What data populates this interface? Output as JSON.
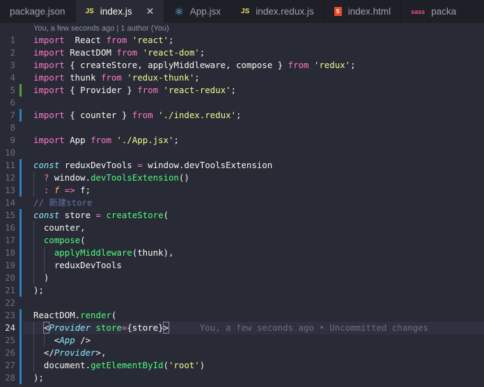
{
  "tabs": [
    {
      "icon": "",
      "icon_name": "json-file-icon",
      "label": "package.json",
      "active": false
    },
    {
      "icon": "JS",
      "icon_name": "js-file-icon",
      "label": "index.js",
      "active": true,
      "close": "✕"
    },
    {
      "icon": "⚛",
      "icon_name": "react-file-icon",
      "label": "App.jsx",
      "active": false
    },
    {
      "icon": "JS",
      "icon_name": "js-file-icon",
      "label": "index.redux.js",
      "active": false
    },
    {
      "icon": "5",
      "icon_name": "html-file-icon",
      "label": "index.html",
      "active": false
    },
    {
      "icon": "sass",
      "icon_name": "sass-file-icon",
      "label": "packa",
      "active": false
    }
  ],
  "codelens": "You, a few seconds ago | 1 author (You)",
  "blame_text": "You, a few seconds ago • Uncommitted changes",
  "current_line": 24,
  "colors": {
    "background": "#282a36",
    "keyword": "#ff79c6",
    "string": "#f1fa8c",
    "function": "#50fa7b",
    "comment": "#6272a4",
    "modified_gutter": "#2e7fc0",
    "added_gutter": "#5d9b3a"
  },
  "lines": [
    {
      "n": "1",
      "g": "",
      "tokens": [
        [
          "k",
          "import"
        ],
        [
          "",
          "  React "
        ],
        [
          "k",
          "from"
        ],
        [
          "",
          " "
        ],
        [
          "s",
          "'react'"
        ],
        [
          "",
          ";"
        ]
      ]
    },
    {
      "n": "2",
      "g": "",
      "tokens": [
        [
          "k",
          "import"
        ],
        [
          "",
          " ReactDOM "
        ],
        [
          "k",
          "from"
        ],
        [
          "",
          " "
        ],
        [
          "s",
          "'react-dom'"
        ],
        [
          "",
          ";"
        ]
      ]
    },
    {
      "n": "3",
      "g": "",
      "tokens": [
        [
          "k",
          "import"
        ],
        [
          "",
          " { createStore, applyMiddleware, compose } "
        ],
        [
          "k",
          "from"
        ],
        [
          "",
          " "
        ],
        [
          "s",
          "'redux'"
        ],
        [
          "",
          ";"
        ]
      ]
    },
    {
      "n": "4",
      "g": "",
      "tokens": [
        [
          "k",
          "import"
        ],
        [
          "",
          " thunk "
        ],
        [
          "k",
          "from"
        ],
        [
          "",
          " "
        ],
        [
          "s",
          "'redux-thunk'"
        ],
        [
          "",
          ";"
        ]
      ]
    },
    {
      "n": "5",
      "g": "add",
      "tokens": [
        [
          "k",
          "import"
        ],
        [
          "",
          " { Provider } "
        ],
        [
          "k",
          "from"
        ],
        [
          "",
          " "
        ],
        [
          "s",
          "'react-redux'"
        ],
        [
          "",
          ";"
        ]
      ]
    },
    {
      "n": "6",
      "g": "",
      "tokens": []
    },
    {
      "n": "7",
      "g": "mod",
      "tokens": [
        [
          "k",
          "import"
        ],
        [
          "",
          " { counter } "
        ],
        [
          "k",
          "from"
        ],
        [
          "",
          " "
        ],
        [
          "s",
          "'./index.redux'"
        ],
        [
          "",
          ";"
        ]
      ]
    },
    {
      "n": "8",
      "g": "",
      "tokens": []
    },
    {
      "n": "9",
      "g": "",
      "tokens": [
        [
          "k",
          "import"
        ],
        [
          "",
          " App "
        ],
        [
          "k",
          "from"
        ],
        [
          "",
          " "
        ],
        [
          "s",
          "'./App.jsx'"
        ],
        [
          "",
          ";"
        ]
      ]
    },
    {
      "n": "10",
      "g": "",
      "tokens": []
    },
    {
      "n": "11",
      "g": "mod",
      "tokens": [
        [
          "i",
          "const"
        ],
        [
          "",
          " reduxDevTools "
        ],
        [
          "k",
          "="
        ],
        [
          "",
          " window.devToolsExtension"
        ]
      ]
    },
    {
      "n": "12",
      "g": "mod",
      "indent": 1,
      "tokens": [
        [
          "",
          "  "
        ],
        [
          "k",
          "?"
        ],
        [
          "",
          " window."
        ],
        [
          "f",
          "devToolsExtension"
        ],
        [
          "",
          "()"
        ]
      ]
    },
    {
      "n": "13",
      "g": "mod",
      "indent": 1,
      "tokens": [
        [
          "",
          "  "
        ],
        [
          "k",
          ":"
        ],
        [
          "",
          " "
        ],
        [
          "ip",
          "f"
        ],
        [
          "",
          " "
        ],
        [
          "k",
          "=>"
        ],
        [
          "",
          " f;"
        ]
      ]
    },
    {
      "n": "14",
      "g": "",
      "tokens": [
        [
          "c",
          "// 新建store"
        ]
      ]
    },
    {
      "n": "15",
      "g": "mod",
      "tokens": [
        [
          "i",
          "const"
        ],
        [
          "",
          " store "
        ],
        [
          "k",
          "="
        ],
        [
          "",
          " "
        ],
        [
          "f",
          "createStore"
        ],
        [
          "",
          "("
        ]
      ]
    },
    {
      "n": "16",
      "g": "mod",
      "indent": 1,
      "tokens": [
        [
          "",
          "  counter,"
        ]
      ]
    },
    {
      "n": "17",
      "g": "mod",
      "indent": 1,
      "tokens": [
        [
          "",
          "  "
        ],
        [
          "f",
          "compose"
        ],
        [
          "",
          "("
        ]
      ]
    },
    {
      "n": "18",
      "g": "mod",
      "indent": 2,
      "tokens": [
        [
          "",
          "    "
        ],
        [
          "f",
          "applyMiddleware"
        ],
        [
          "",
          "(thunk),"
        ]
      ]
    },
    {
      "n": "19",
      "g": "mod",
      "indent": 2,
      "tokens": [
        [
          "",
          "    reduxDevTools"
        ]
      ]
    },
    {
      "n": "20",
      "g": "mod",
      "indent": 1,
      "tokens": [
        [
          "",
          "  )"
        ]
      ]
    },
    {
      "n": "21",
      "g": "mod",
      "tokens": [
        [
          "",
          ");"
        ]
      ]
    },
    {
      "n": "22",
      "g": "",
      "tokens": []
    },
    {
      "n": "23",
      "g": "mod",
      "tokens": [
        [
          "",
          "ReactDOM."
        ],
        [
          "f",
          "render"
        ],
        [
          "",
          "("
        ]
      ]
    },
    {
      "n": "24",
      "g": "mod",
      "indent": 1,
      "cur": true,
      "tokens": [
        [
          "",
          "  "
        ],
        [
          "br",
          "<"
        ],
        [
          "t",
          "Provider"
        ],
        [
          "",
          " "
        ],
        [
          "f",
          "store"
        ],
        [
          "k",
          "="
        ],
        [
          "",
          "{store}"
        ],
        [
          "br",
          ">"
        ],
        [
          "",
          "      "
        ]
      ]
    },
    {
      "n": "25",
      "g": "mod",
      "indent": 2,
      "tokens": [
        [
          "",
          "    <"
        ],
        [
          "t",
          "App"
        ],
        [
          "",
          " />"
        ]
      ]
    },
    {
      "n": "26",
      "g": "mod",
      "indent": 1,
      "tokens": [
        [
          "",
          "  </"
        ],
        [
          "t",
          "Provider"
        ],
        [
          "",
          ">,"
        ]
      ]
    },
    {
      "n": "27",
      "g": "mod",
      "indent": 1,
      "tokens": [
        [
          "",
          "  document."
        ],
        [
          "f",
          "getElementById"
        ],
        [
          "",
          "("
        ],
        [
          "s",
          "'root'"
        ],
        [
          "",
          ")"
        ]
      ]
    },
    {
      "n": "28",
      "g": "mod",
      "tokens": [
        [
          "",
          ");"
        ]
      ]
    }
  ]
}
